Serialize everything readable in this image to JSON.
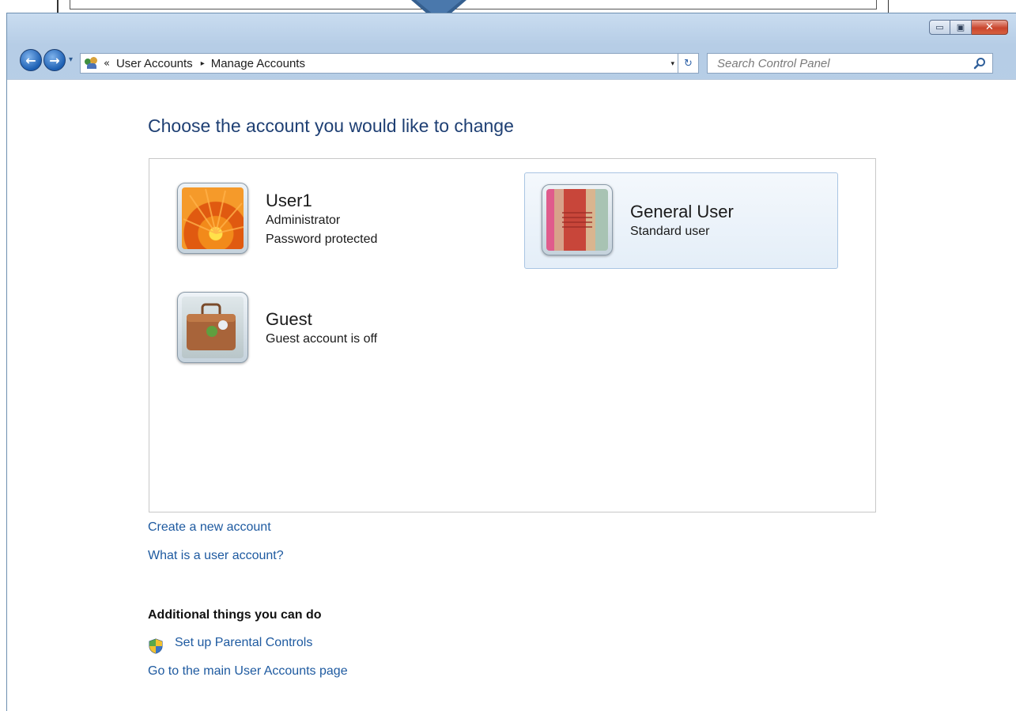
{
  "window": {
    "caption": {
      "minimize_glyph": "▭",
      "maximize_glyph": "▣",
      "close_glyph": "✕"
    }
  },
  "navigation": {
    "back_glyph": "←",
    "forward_glyph": "→",
    "history_glyph": "▾"
  },
  "address": {
    "chevron": "«",
    "crumbs": [
      "User Accounts",
      "Manage Accounts"
    ],
    "separator": "▸",
    "dropdown_glyph": "▾",
    "refresh_glyph": "↻"
  },
  "search": {
    "placeholder": "Search Control Panel"
  },
  "main": {
    "title": "Choose the account you would like to change",
    "accounts": [
      {
        "name": "User1",
        "lines": [
          "Administrator",
          "Password protected"
        ],
        "picture": "orange-flower",
        "selected": false
      },
      {
        "name": "General User",
        "lines": [
          "Standard user"
        ],
        "picture": "fabric-stripes",
        "selected": true
      },
      {
        "name": "Guest",
        "lines": [
          "Guest account is off"
        ],
        "picture": "suitcase",
        "selected": false
      }
    ],
    "links": {
      "create_account": "Create a new account",
      "what_is_account": "What is a user account?"
    },
    "additional": {
      "heading": "Additional things you can do",
      "parental_controls": "Set up Parental Controls",
      "main_page": "Go to the main User Accounts page"
    }
  },
  "colors": {
    "accent_link": "#1e5aa0",
    "title_blue": "#1e3f73",
    "window_frame": "#b6cde6",
    "close_red": "#c9452d"
  }
}
